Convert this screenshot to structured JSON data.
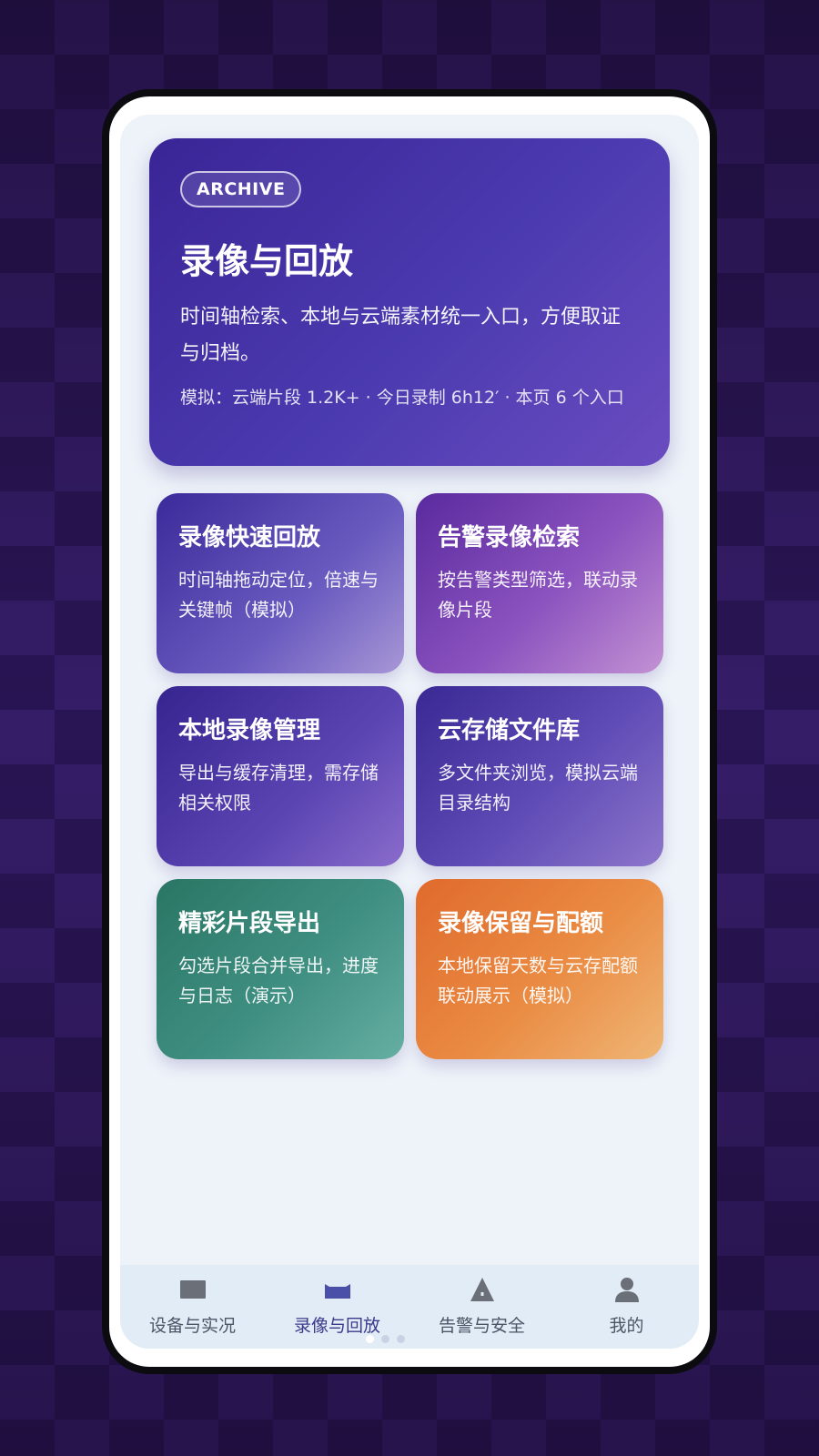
{
  "hero": {
    "badge": "ARCHIVE",
    "title": "录像与回放",
    "description": "时间轴检索、本地与云端素材统一入口，方便取证与归档。",
    "stats": "模拟：云端片段 1.2K+ · 今日录制 6h12′ · 本页 6 个入口"
  },
  "cards": [
    {
      "title": "录像快速回放",
      "desc": "时间轴拖动定位，倍速与关键帧（模拟）"
    },
    {
      "title": "告警录像检索",
      "desc": "按告警类型筛选，联动录像片段"
    },
    {
      "title": "本地录像管理",
      "desc": "导出与缓存清理，需存储相关权限"
    },
    {
      "title": "云存储文件库",
      "desc": "多文件夹浏览，模拟云端目录结构"
    },
    {
      "title": "精彩片段导出",
      "desc": "勾选片段合并导出，进度与日志（演示）"
    },
    {
      "title": "录像保留与配额",
      "desc": "本地保留天数与云存配额联动展示（模拟）"
    }
  ],
  "nav": {
    "items": [
      {
        "label": "设备与实况",
        "icon": "monitor-icon"
      },
      {
        "label": "录像与回放",
        "icon": "tray-icon"
      },
      {
        "label": "告警与安全",
        "icon": "warning-icon"
      },
      {
        "label": "我的",
        "icon": "person-icon"
      }
    ],
    "active_index": 1
  },
  "colors": {
    "hero_start": "#3a2596",
    "nav_background": "#e2ecf6",
    "active_icon": "#4a4fa8",
    "inactive_icon": "#6b6f78"
  }
}
